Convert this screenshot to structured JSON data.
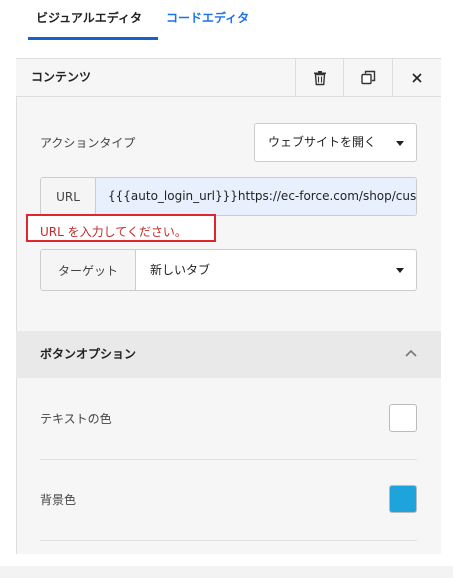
{
  "tabs": {
    "visual": "ビジュアルエディタ",
    "code": "コードエディタ"
  },
  "panel": {
    "title": "コンテンツ",
    "header_icons": [
      "trash-icon",
      "copy-icon",
      "close-icon"
    ]
  },
  "action_type": {
    "label": "アクションタイプ",
    "value": "ウェブサイトを開く"
  },
  "url": {
    "addon": "URL",
    "value": "{{{auto_login_url}}}https://ec-force.com/shop/custor",
    "error": "URL を入力してください。"
  },
  "target": {
    "addon": "ターゲット",
    "value": "新しいタブ"
  },
  "button_options": {
    "title": "ボタンオプション",
    "text_color_label": "テキストの色",
    "bg_color_label": "背景色",
    "text_color": "#ffffff",
    "bg_color": "#1fa3dd"
  },
  "colors": {
    "accent": "#1a73e8",
    "error": "#e0252f"
  }
}
